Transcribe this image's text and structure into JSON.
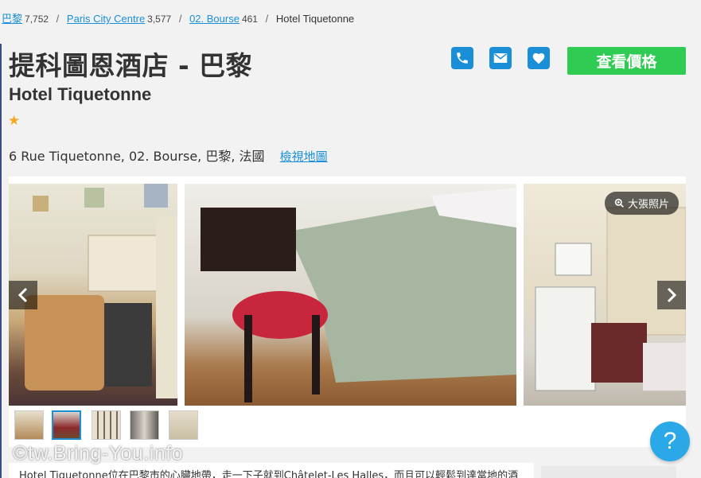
{
  "breadcrumb": {
    "items": [
      {
        "label": "巴黎",
        "count": "7,752"
      },
      {
        "label": "Paris City Centre",
        "count": "3,577"
      },
      {
        "label": "02. Bourse",
        "count": "461"
      }
    ],
    "current": "Hotel Tiquetonne",
    "separator": "/"
  },
  "hotel": {
    "title": "提科圖恩酒店 - 巴黎",
    "subtitle": "Hotel Tiquetonne",
    "stars": 1,
    "star_glyph": "★",
    "address": "6 Rue Tiquetonne, 02. Bourse, 巴黎, 法國",
    "map_link": "檢視地圖"
  },
  "actions": {
    "icons": [
      "phone-icon",
      "mail-icon",
      "heart-icon"
    ],
    "check_price": "查看價格"
  },
  "gallery": {
    "enlarge_label": "大張照片",
    "thumb_count": 5,
    "active_thumb": 2
  },
  "description": "Hotel Tiquetonne位在巴黎市的心臟地帶，走一下子就到Châtelet-Les Halles，而且可以輕鬆到達當地的酒",
  "watermark": "©tw.Bring-You.info",
  "help_label": "?",
  "colors": {
    "accent": "#1a8fd8",
    "cta": "#2fcb52",
    "star": "#f5a623"
  }
}
